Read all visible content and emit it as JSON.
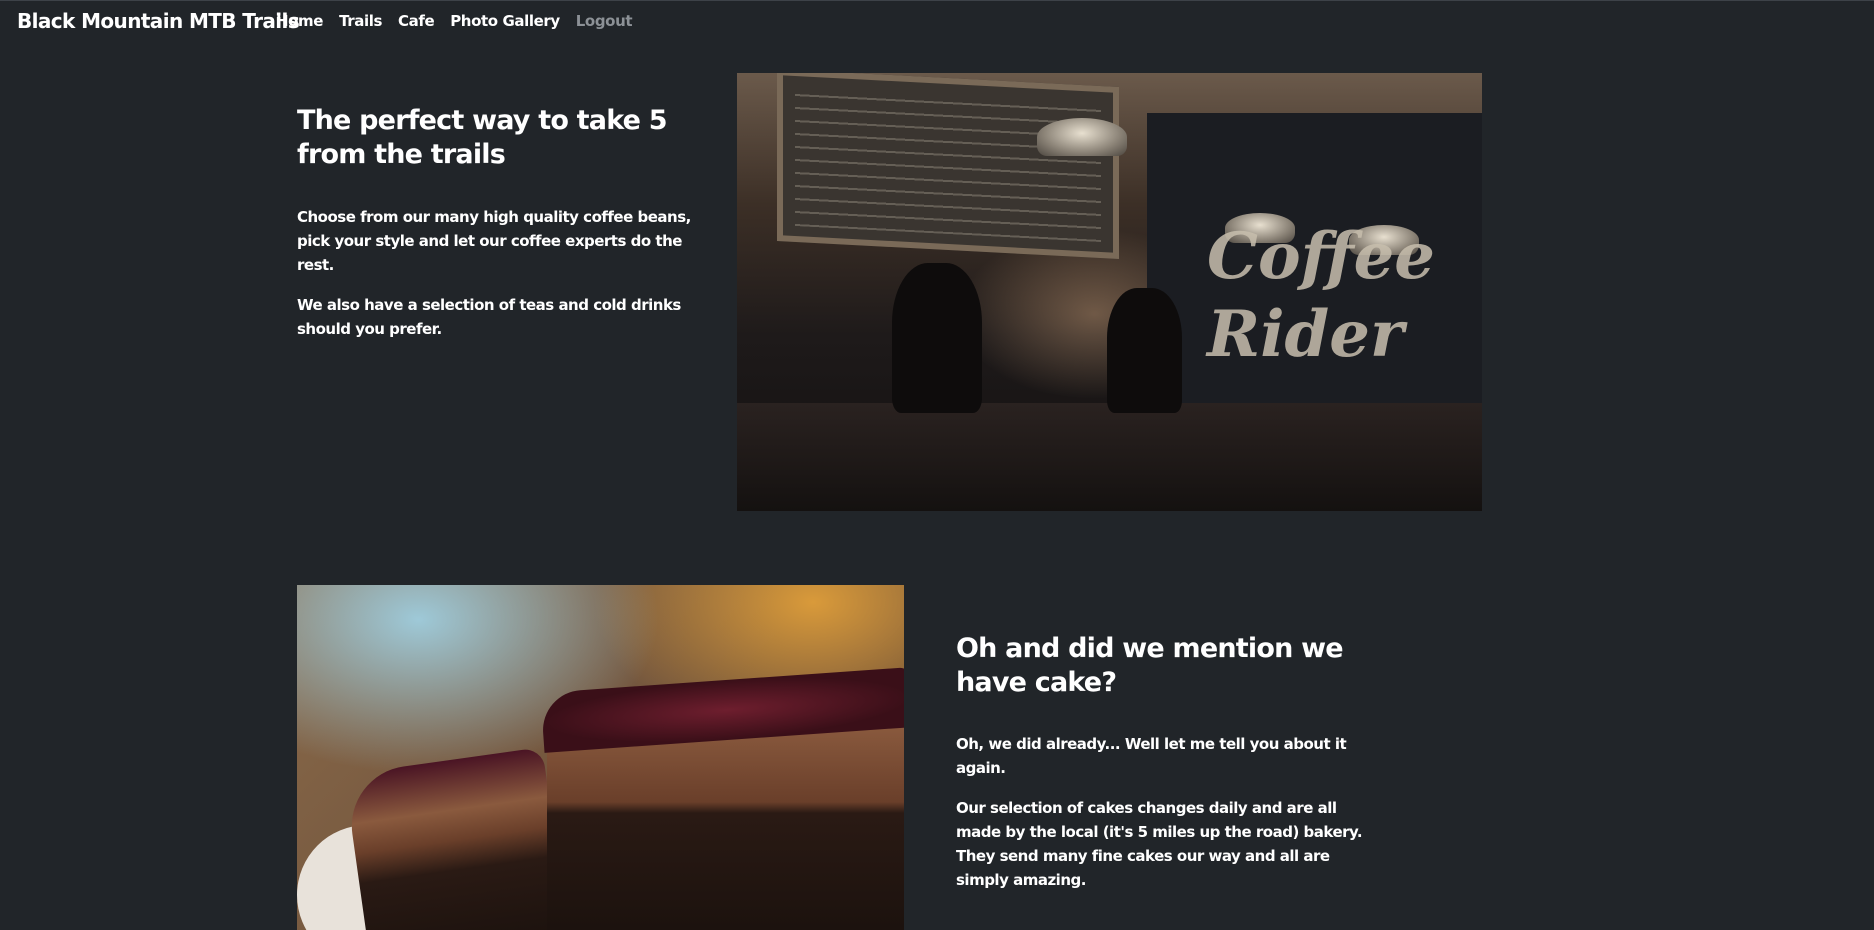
{
  "navbar": {
    "brand": "Black Mountain MTB Trails",
    "links": [
      {
        "label": "Home"
      },
      {
        "label": "Trails"
      },
      {
        "label": "Cafe"
      },
      {
        "label": "Photo Gallery"
      },
      {
        "label": "Logout"
      }
    ]
  },
  "section1": {
    "heading": "The perfect way to take 5 from the trails",
    "paragraphs": [
      "Choose from our many high quality coffee beans, pick your style and let our coffee experts do the rest.",
      "We also have a selection of teas and cold drinks should you prefer."
    ],
    "image": {
      "sign_text_line1": "Coffee",
      "sign_text_line2": "Rider"
    }
  },
  "section2": {
    "heading": "Oh and did we mention we have cake?",
    "paragraphs": [
      "Oh, we did already... Well let me tell you about it again.",
      "Our selection of cakes changes daily and are all made by the local (it's 5 miles up the road) bakery. They send many fine cakes our way and all are simply amazing."
    ]
  },
  "colors": {
    "background": "#212529",
    "text": "#ffffff",
    "muted_link": "#8c9196"
  }
}
